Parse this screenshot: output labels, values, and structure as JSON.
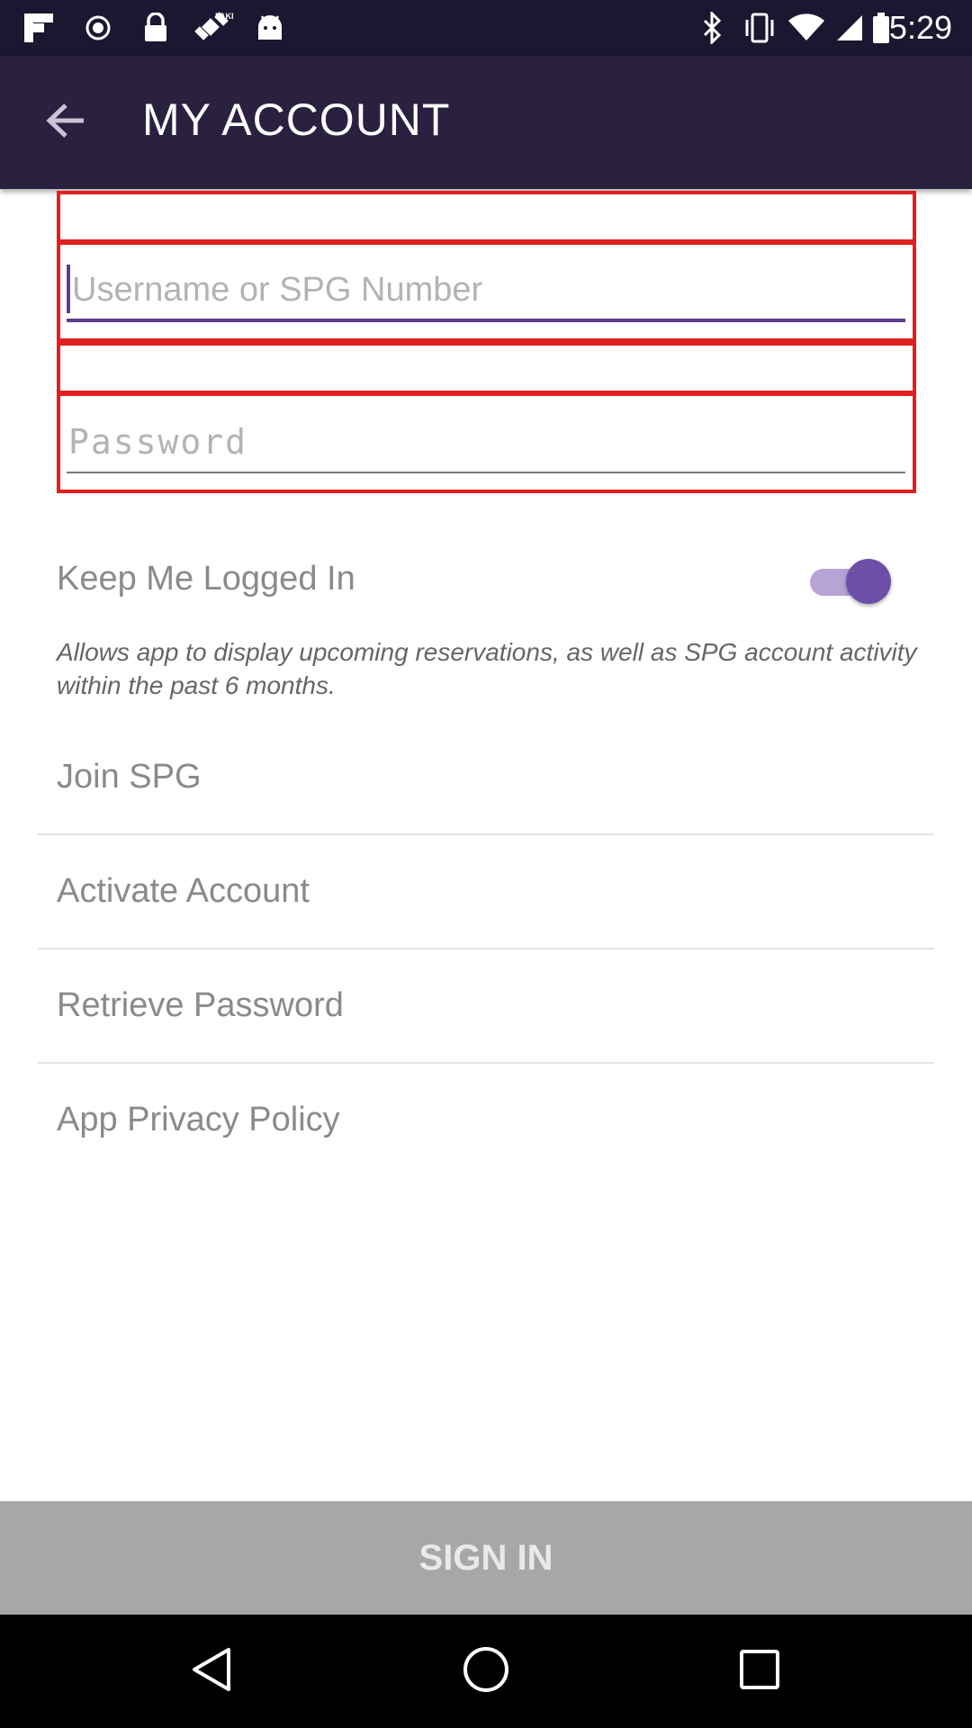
{
  "status_bar": {
    "time": "5:29",
    "left_icons": [
      "flipboard-icon",
      "circle-icon",
      "lock-icon",
      "fake-gps-icon",
      "android-icon"
    ],
    "right_icons": [
      "bluetooth-icon",
      "vibrate-icon",
      "wifi-icon",
      "signal-icon",
      "battery-icon"
    ]
  },
  "app_bar": {
    "back_icon": "arrow-back-icon",
    "title": "MY ACCOUNT"
  },
  "form": {
    "username_placeholder": "Username or SPG Number",
    "password_placeholder": "Password",
    "highlight_color": "#e0201e",
    "focus_color": "#5c3d8c"
  },
  "keep_logged_in": {
    "label": "Keep Me Logged In",
    "enabled": true,
    "description": "Allows app to display upcoming reservations, as well as SPG account activity within the past 6 months."
  },
  "links": [
    {
      "label": "Join SPG"
    },
    {
      "label": "Activate Account"
    },
    {
      "label": "Retrieve Password"
    },
    {
      "label": "App Privacy Policy"
    }
  ],
  "sign_in": {
    "label": "SIGN IN",
    "enabled": false
  },
  "nav_bar": {
    "icons": [
      "back-triangle-icon",
      "home-circle-icon",
      "recents-square-icon"
    ]
  },
  "colors": {
    "status_bar": "#1c1630",
    "app_bar": "#2a2140",
    "toggle_thumb": "#6e4fa8",
    "toggle_track": "#b7a3d6",
    "sign_in_bg": "#a7a7a7"
  }
}
